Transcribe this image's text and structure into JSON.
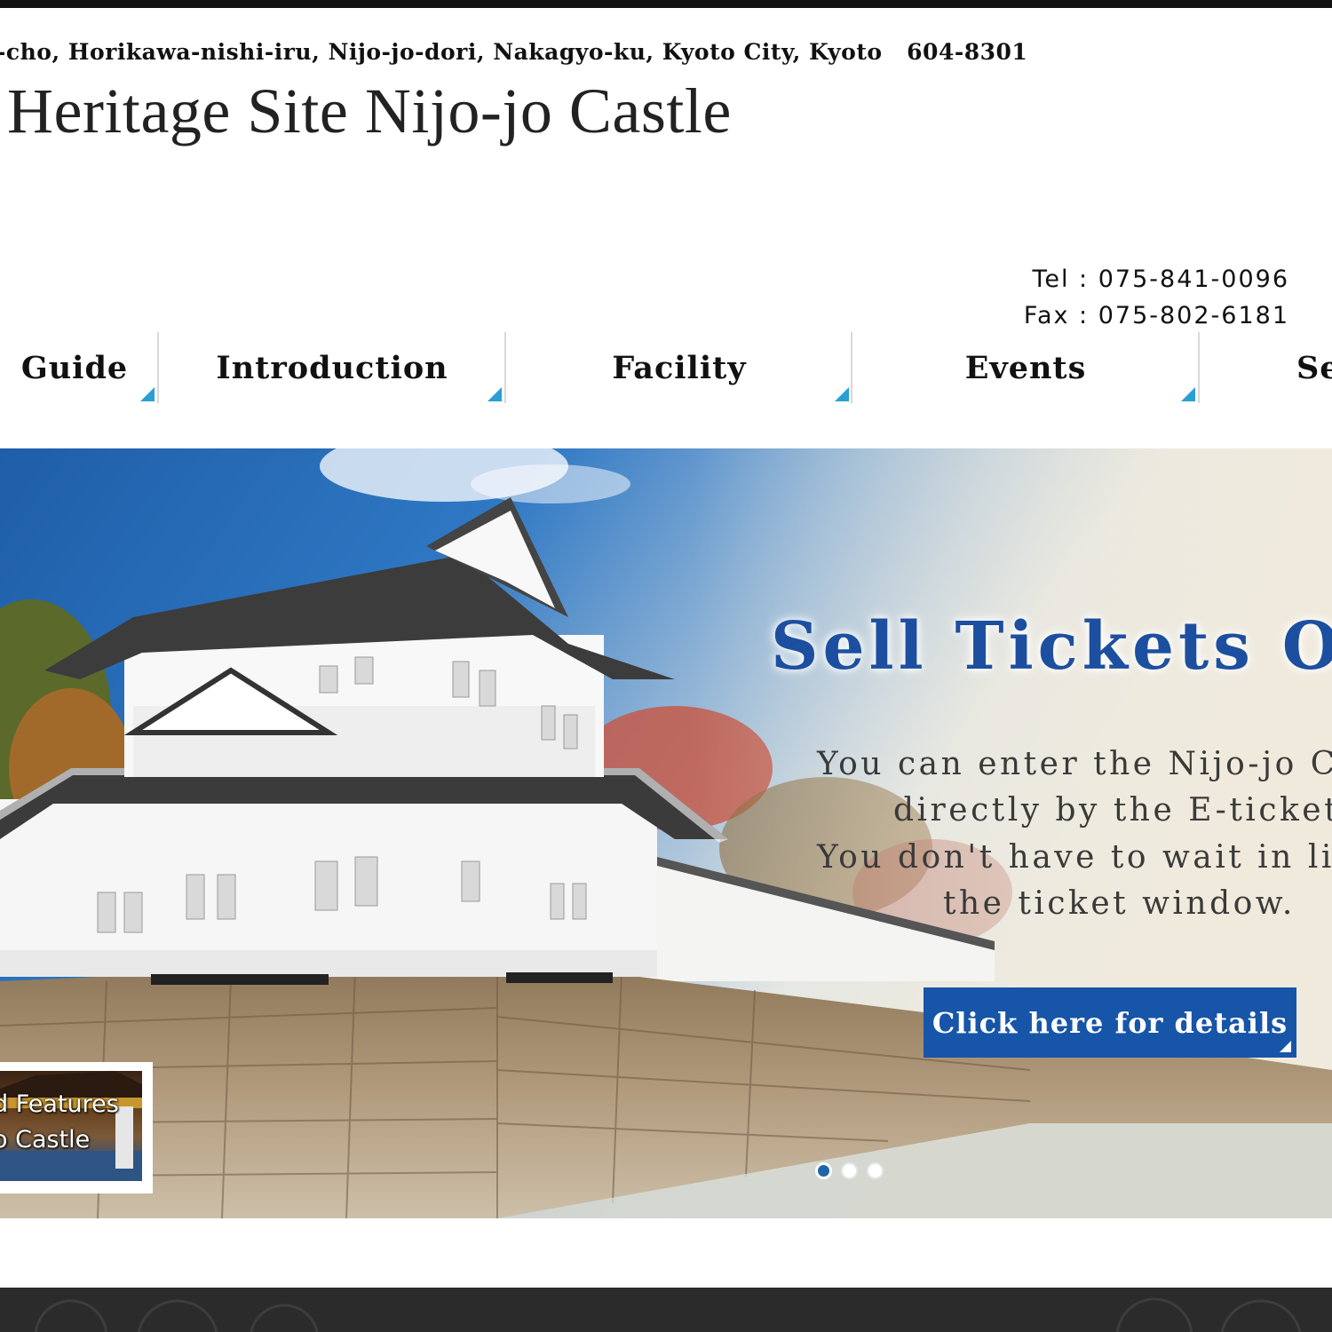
{
  "header": {
    "address": "-cho, Horikawa-nishi-iru, Nijo-jo-dori, Nakagyo-ku, Kyoto City, Kyoto   604-8301",
    "site_title": "Heritage Site Nijo-jo Castle",
    "tel": "Tel : 075-841-0096",
    "fax": "Fax : 075-802-6181"
  },
  "nav": {
    "items": [
      {
        "label": "Guide"
      },
      {
        "label": "Introduction"
      },
      {
        "label": "Facility"
      },
      {
        "label": "Events"
      },
      {
        "label": "Se"
      }
    ],
    "indicator_color": "#2a9fd6"
  },
  "hero": {
    "title": "Sell Tickets Onl",
    "lines": [
      "You can enter the Nijo-jo Ca",
      "directly by the E-ticket.",
      "You don't have to wait in lin",
      "the ticket window."
    ],
    "button_label": "Click here for details",
    "button_color": "#1755a8",
    "title_color": "#1d4fa0",
    "slides_total": 3,
    "active_slide": 1
  },
  "feature_card": {
    "line1": "d Features",
    "line2": "o Castle"
  }
}
